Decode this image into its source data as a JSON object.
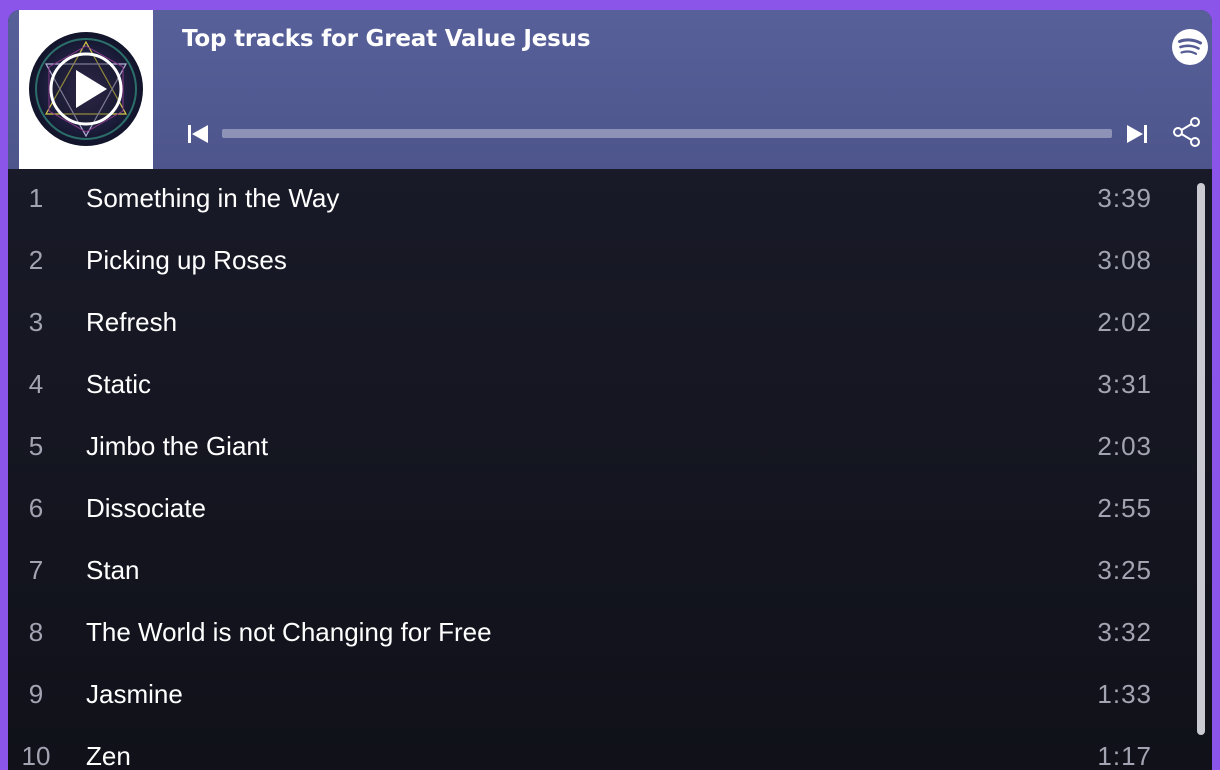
{
  "header": {
    "title": "Top tracks for Great Value Jesus",
    "playback_progress": 0.0
  },
  "icons": {
    "cover_play": "play-icon",
    "logo": "spotify-logo-icon",
    "prev": "skip-back-icon",
    "next": "skip-forward-icon",
    "share": "share-icon"
  },
  "colors": {
    "background_accent": "#8a55e8",
    "header": "#545c93",
    "list_bg": "#15161f",
    "text": "#ffffff",
    "muted": "#a3a4b2"
  },
  "tracks": [
    {
      "num": "1",
      "name": "Something in the Way",
      "duration": "3:39"
    },
    {
      "num": "2",
      "name": "Picking up Roses",
      "duration": "3:08"
    },
    {
      "num": "3",
      "name": "Refresh",
      "duration": "2:02"
    },
    {
      "num": "4",
      "name": "Static",
      "duration": "3:31"
    },
    {
      "num": "5",
      "name": "Jimbo the Giant",
      "duration": "2:03"
    },
    {
      "num": "6",
      "name": "Dissociate",
      "duration": "2:55"
    },
    {
      "num": "7",
      "name": "Stan",
      "duration": "3:25"
    },
    {
      "num": "8",
      "name": "The World is not Changing for Free",
      "duration": "3:32"
    },
    {
      "num": "9",
      "name": "Jasmine",
      "duration": "1:33"
    },
    {
      "num": "10",
      "name": "Zen",
      "duration": "1:17"
    }
  ]
}
